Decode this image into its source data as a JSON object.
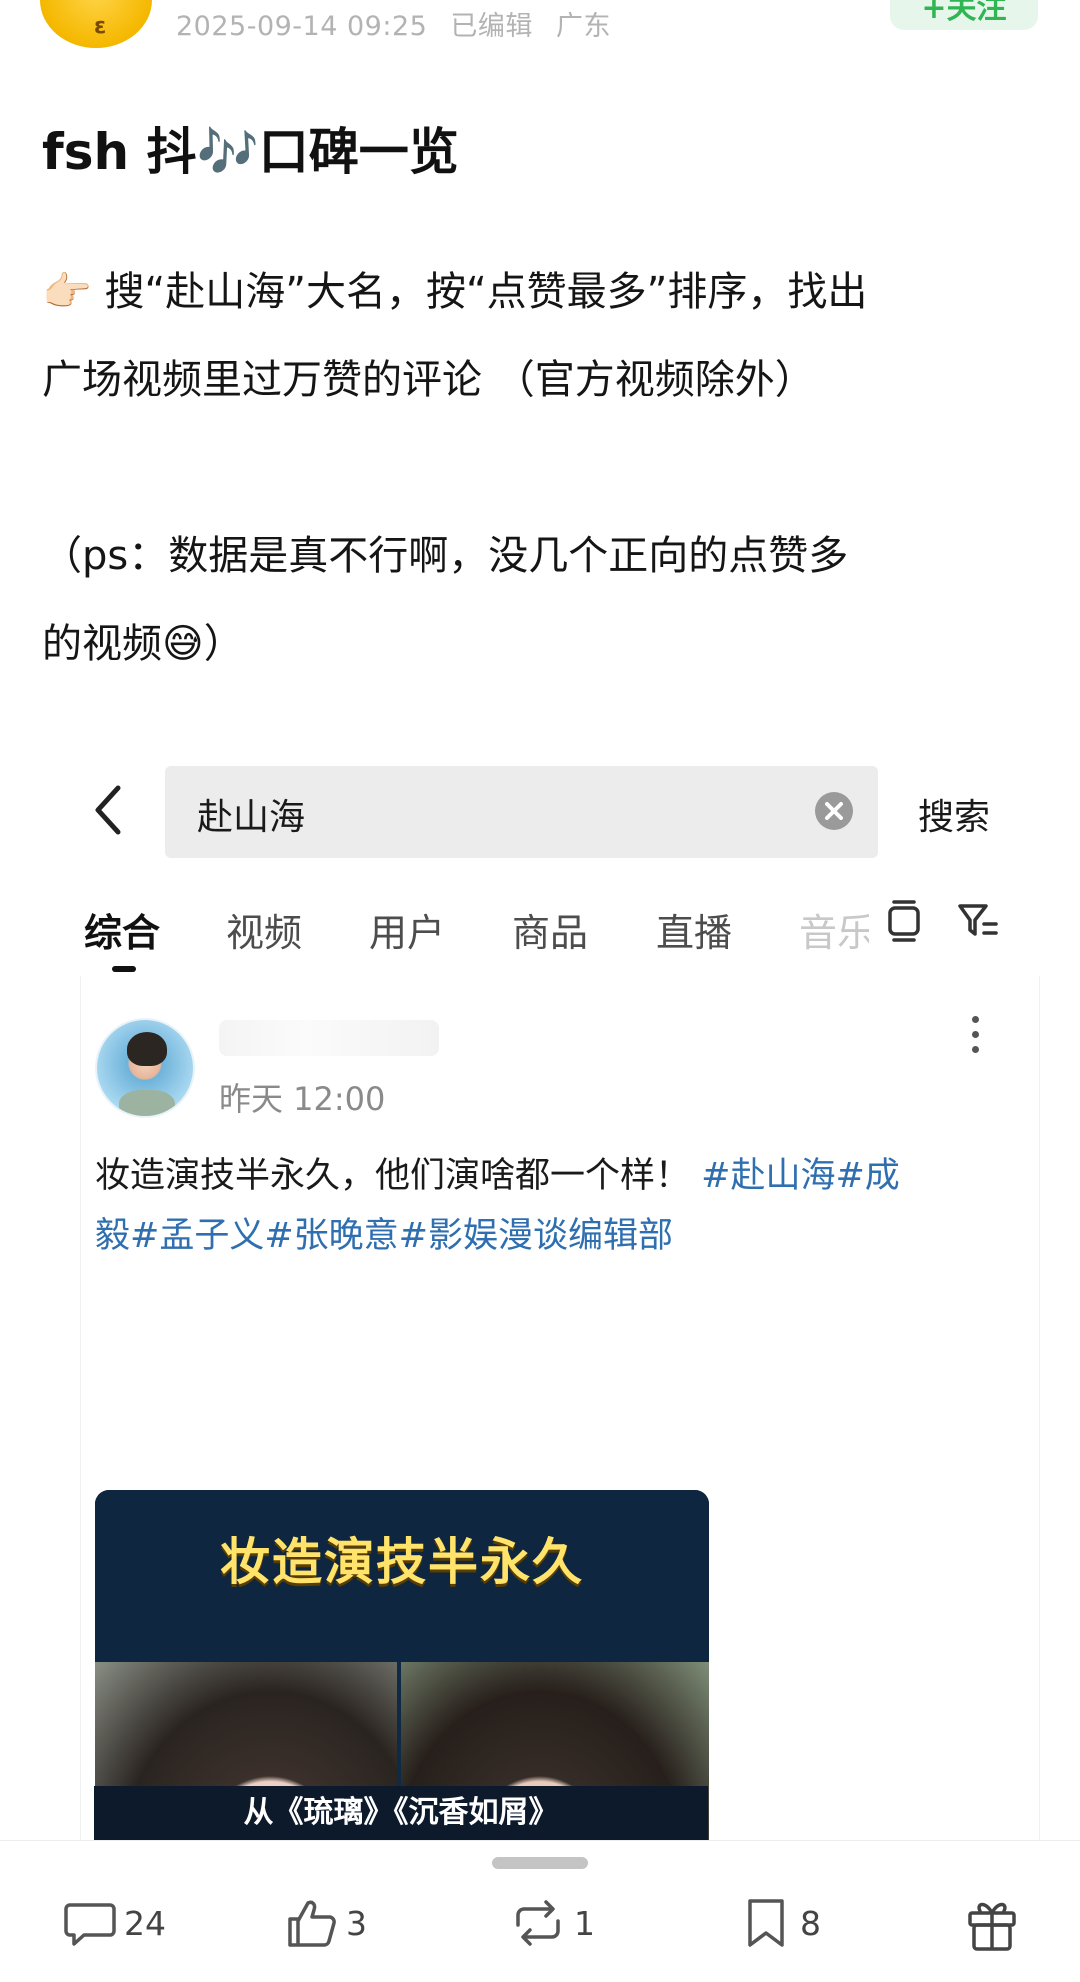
{
  "header": {
    "timestamp": "2025-09-14 09:25",
    "edited": "已编辑",
    "location": "广东",
    "follow_label": "+关注"
  },
  "post": {
    "title": "fsh 抖🎶口碑一览",
    "line1": "👉🏻 搜“赴山海”大名，按“点赞最多”排序，找出",
    "line2": "广场视频里过万赞的评论 （官方视频除外）",
    "line3": "（ps：数据是真不行啊，没几个正向的点赞多",
    "line4": "的视频😅）"
  },
  "search": {
    "query": "赴山海",
    "button_label": "搜索"
  },
  "tabs": [
    "综合",
    "视频",
    "用户",
    "商品",
    "直播",
    "音乐"
  ],
  "card": {
    "time": "昨天 12:00",
    "text_plain": "妆造演技半永久，他们演啥都一个样！",
    "hashtags_line1": "#赴山海#成",
    "hashtags_line2": "毅#孟子义#张晚意#影娱漫谈编辑部",
    "thumb_title": "妆造演技半永久",
    "thumb_caption": "从《琉璃》《沉香如屑》"
  },
  "actions": {
    "comments": "24",
    "likes": "3",
    "reposts": "1",
    "bookmarks": "8"
  },
  "icons": {
    "comment": "comment-icon",
    "like": "thumbs-up-icon",
    "repost": "repost-icon",
    "bookmark": "bookmark-icon",
    "gift": "gift-icon"
  },
  "colors": {
    "hashtag": "#2f6fb0",
    "follow_green": "#2fb552",
    "meta_gray": "#b3b3b3"
  }
}
